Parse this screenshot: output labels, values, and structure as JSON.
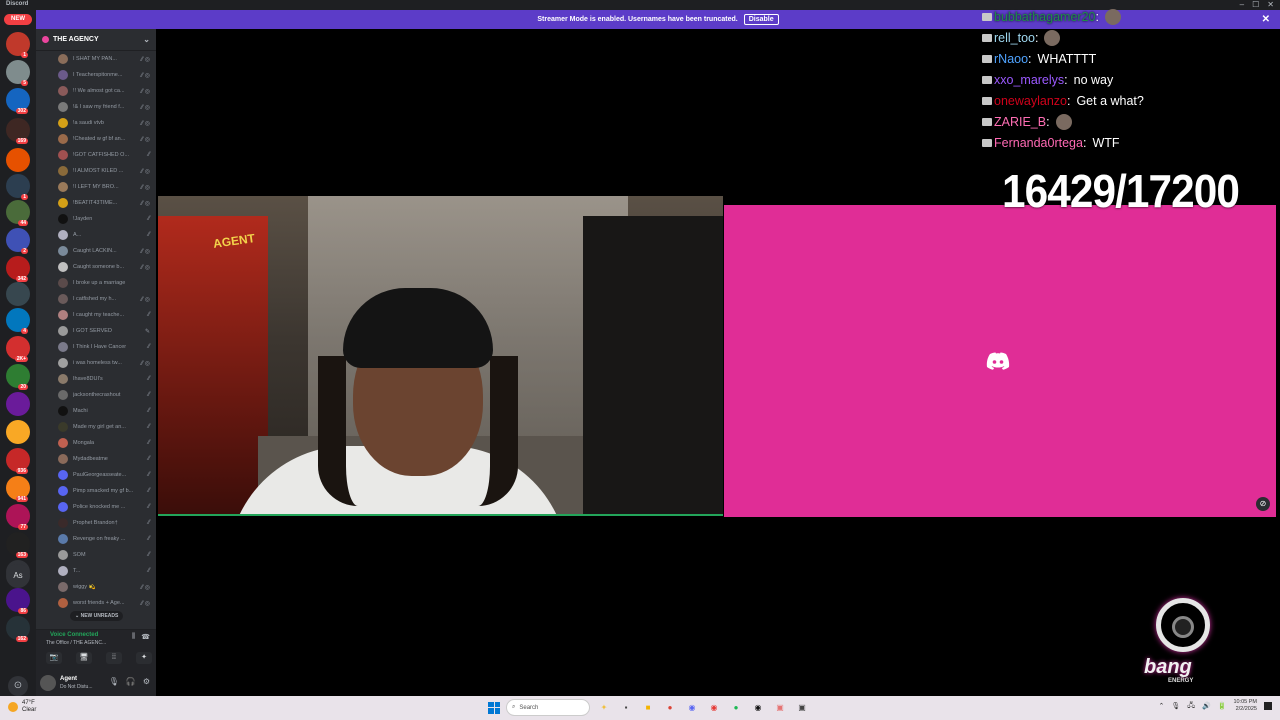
{
  "window": {
    "app_name": "Discord",
    "controls": [
      "–",
      "☐",
      "✕"
    ]
  },
  "banner": {
    "text": "Streamer Mode is enabled. Usernames have been truncated.",
    "disable_label": "Disable",
    "close_glyph": "✕"
  },
  "rail": {
    "new_label": "NEW",
    "servers": [
      {
        "badge": "1",
        "color": "#c0392b"
      },
      {
        "badge": "5",
        "color": "#7f8c8d"
      },
      {
        "badge": "302",
        "color": "#1565c0"
      },
      {
        "badge": "169",
        "color": "#3e2723"
      },
      {
        "badge": "",
        "color": "#e65100"
      },
      {
        "badge": "1",
        "color": "#2c3e50"
      },
      {
        "badge": "44",
        "color": "#4a6b3a"
      },
      {
        "badge": "2",
        "color": "#3f51b5"
      },
      {
        "badge": "342",
        "color": "#b71c1c"
      },
      {
        "badge": "",
        "color": "#37474f"
      },
      {
        "badge": "4",
        "color": "#0277bd"
      },
      {
        "badge": "2K+",
        "color": "#d32f2f"
      },
      {
        "badge": "20",
        "color": "#2e7d32"
      },
      {
        "badge": "",
        "color": "#6a1b9a"
      },
      {
        "badge": "",
        "color": "#f9a825"
      },
      {
        "badge": "936",
        "color": "#c62828"
      },
      {
        "badge": "941",
        "color": "#f57f17"
      },
      {
        "badge": "77",
        "color": "#ad1457"
      },
      {
        "badge": "163",
        "color": "#212121"
      },
      {
        "badge": "",
        "color": "#313338"
      },
      {
        "badge": "86",
        "color": "#4a148c"
      },
      {
        "badge": "162",
        "color": "#263238"
      }
    ],
    "as_label": "As",
    "bottom_glyph": "⊙"
  },
  "sidebar": {
    "guild_name": "THE AGENCY",
    "channels": [
      {
        "name": "I SHAT MY PAN...",
        "icons": "⁄⁄ ◎",
        "color": "#8a6d5a"
      },
      {
        "name": "I Teacherspitonme...",
        "icons": "⁄⁄ ◎",
        "color": "#6b5a8a"
      },
      {
        "name": "!! We almost got ca...",
        "icons": "⁄⁄ ◎",
        "color": "#8a5a5a"
      },
      {
        "name": "!& I saw my friend f...",
        "icons": "⁄⁄ ◎",
        "color": "#7a7a7a"
      },
      {
        "name": "!a saudi vtvb",
        "icons": "⁄⁄ ◎",
        "color": "#d4a017"
      },
      {
        "name": "!Cheated w gf bf an...",
        "icons": "⁄⁄ ◎",
        "color": "#9a6a4a"
      },
      {
        "name": "!GOT CATFISHED O...",
        "icons": "⁄⁄",
        "color": "#a05050"
      },
      {
        "name": "!I ALMOST KILED ...",
        "icons": "⁄⁄ ◎",
        "color": "#8a6a3a"
      },
      {
        "name": "!I LEFT MY BRO...",
        "icons": "⁄⁄ ◎",
        "color": "#9a7a5a"
      },
      {
        "name": "!BEATIT43TIME...",
        "icons": "⁄⁄ ◎",
        "color": "#d4a017"
      },
      {
        "name": "!Jayden",
        "icons": "⁄⁄",
        "color": "#111111"
      },
      {
        "name": "A...",
        "icons": "⁄⁄",
        "color": "#b0b0c0"
      },
      {
        "name": "Caught LACKIN...",
        "icons": "⁄⁄ ◎",
        "color": "#7a8a9a"
      },
      {
        "name": "Caught someone b...",
        "icons": "⁄⁄ ◎",
        "color": "#c0c0c0"
      },
      {
        "name": "I broke up a marriage",
        "icons": "",
        "color": "#5a4a4a"
      },
      {
        "name": "I catfished my h...",
        "icons": "⁄⁄ ◎",
        "color": "#6a5a5a"
      },
      {
        "name": "I caught my teache...",
        "icons": "⁄⁄",
        "color": "#b08080"
      },
      {
        "name": "I GOT SERVED",
        "icons": "✎",
        "color": "#9a9a9a"
      },
      {
        "name": "I Think I Have Cancer",
        "icons": "⁄⁄",
        "color": "#7a7a8a"
      },
      {
        "name": "i was homeless tw...",
        "icons": "⁄⁄ ◎",
        "color": "#a0a0a0"
      },
      {
        "name": "Ihave8DUI's",
        "icons": "⁄⁄",
        "color": "#8a7a6a"
      },
      {
        "name": "jacksonthecrashout",
        "icons": "⁄⁄",
        "color": "#6a6a6a"
      },
      {
        "name": "Machi",
        "icons": "⁄⁄",
        "color": "#111111"
      },
      {
        "name": "Made my girl get an...",
        "icons": "⁄⁄",
        "color": "#3a3a2a"
      },
      {
        "name": "Mongala",
        "icons": "⁄⁄",
        "color": "#c06050"
      },
      {
        "name": "Mydadbeatme",
        "icons": "⁄⁄",
        "color": "#8a6a5a"
      },
      {
        "name": "PaulGeorgeasseate...",
        "icons": "⁄⁄",
        "color": "#5865f2"
      },
      {
        "name": "Pimp smacked my gf b...",
        "icons": "⁄⁄",
        "color": "#5865f2"
      },
      {
        "name": "Police knocked me ...",
        "icons": "⁄⁄",
        "color": "#5865f2"
      },
      {
        "name": "Prophet Brandon†",
        "icons": "⁄⁄",
        "color": "#3a2a2a"
      },
      {
        "name": "Revenge on freaky ...",
        "icons": "⁄⁄",
        "color": "#5a7aaa"
      },
      {
        "name": "SOM",
        "icons": "⁄⁄",
        "color": "#9a9a9a"
      },
      {
        "name": "T...",
        "icons": "⁄⁄",
        "color": "#b0b0c0"
      },
      {
        "name": "wiggy 💫",
        "icons": "⁄⁄ ◎",
        "color": "#7a6a6a"
      },
      {
        "name": "worst friends + Age...",
        "icons": "⁄⁄ ◎",
        "color": "#b06040"
      }
    ],
    "new_unreads": "⌄ NEW UNREADS",
    "voice": {
      "status": "Voice Connected",
      "location": "The Office / THE AGENC...",
      "buttons": [
        "📷",
        "🖥",
        "⁞⁞",
        "✦"
      ]
    },
    "user": {
      "name": "Agent",
      "status": "Do Not Distu..."
    }
  },
  "overlay": {
    "goal": "16429/17200",
    "chat": [
      {
        "user": "bubbathagamer20",
        "sep": ":",
        "msg": "",
        "color": "#1f8b4c",
        "emote": true
      },
      {
        "user": "rell_too",
        "sep": ":",
        "msg": "",
        "color": "#9fd8f0",
        "emote": true
      },
      {
        "user": "rNaoo",
        "sep": ":",
        "msg": "WHATTTT",
        "color": "#4fa3ff",
        "emote": false
      },
      {
        "user": "xxo_marelys",
        "sep": ":",
        "msg": "no way",
        "color": "#9b59ff",
        "emote": false
      },
      {
        "user": "onewaylanzo",
        "sep": ":",
        "msg": "Get a what?",
        "color": "#d0021b",
        "emote": false
      },
      {
        "user": "ZARIE_B",
        "sep": ":",
        "msg": "",
        "color": "#ff6eb4",
        "emote": true
      },
      {
        "user": "Fernanda0rtega",
        "sep": ":",
        "msg": "WTF",
        "color": "#ff69b4",
        "emote": false
      }
    ],
    "sponsor": {
      "name": "bang",
      "sub": "ENERGY"
    }
  },
  "taskbar": {
    "weather": {
      "temp": "47°F",
      "desc": "Clear"
    },
    "search_placeholder": "Search",
    "apps": [
      {
        "glyph": "✦",
        "color": "#f0c040"
      },
      {
        "glyph": "▪",
        "color": "#444"
      },
      {
        "glyph": "■",
        "color": "#f4b400"
      },
      {
        "glyph": "●",
        "color": "#db4437"
      },
      {
        "glyph": "◉",
        "color": "#5865f2"
      },
      {
        "glyph": "◉",
        "color": "#e53935"
      },
      {
        "glyph": "●",
        "color": "#1db954"
      },
      {
        "glyph": "◉",
        "color": "#111"
      },
      {
        "glyph": "▣",
        "color": "#e57373"
      },
      {
        "glyph": "▣",
        "color": "#444"
      }
    ],
    "tray": [
      "⌃",
      "🎙",
      "🖧",
      "🔊",
      "🔋"
    ],
    "time": "10:05 PM",
    "date": "2/2/2025"
  }
}
